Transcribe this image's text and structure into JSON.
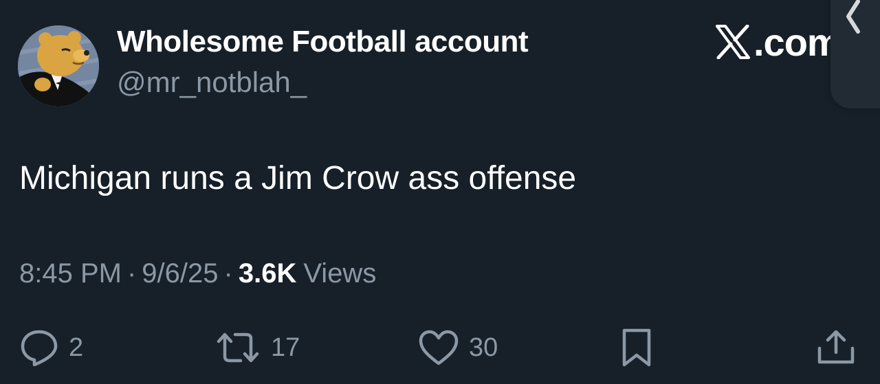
{
  "author": {
    "display_name": "Wholesome Football account",
    "handle": "@mr_notblah_",
    "avatar_icon": "tuxedo-bear-avatar"
  },
  "brand": {
    "label": ".com",
    "icon": "x-logo-icon"
  },
  "tweet": {
    "text": "Michigan runs a Jim Crow ass offense"
  },
  "meta": {
    "time": "8:45 PM",
    "separator": "·",
    "date": "9/6/25",
    "views_count": "3.6K",
    "views_label": "Views"
  },
  "actions": {
    "replies": "2",
    "reposts": "17",
    "likes": "30",
    "icons": [
      "reply-icon",
      "repost-icon",
      "like-icon",
      "bookmark-icon",
      "share-icon"
    ]
  },
  "colors": {
    "background": "#172029",
    "primary_text": "#ffffff",
    "secondary_text": "#8b98a5"
  }
}
